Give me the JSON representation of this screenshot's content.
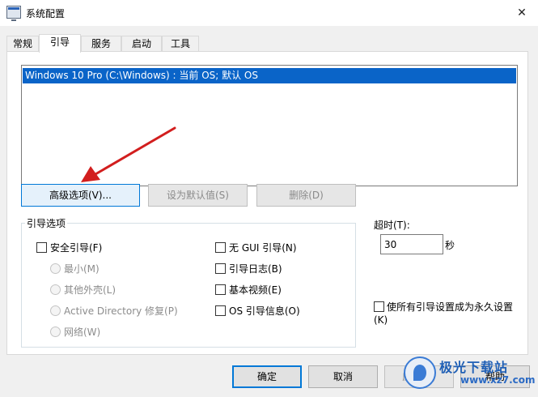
{
  "window": {
    "title": "系统配置",
    "close_glyph": "✕"
  },
  "tabs": [
    {
      "label": "常规"
    },
    {
      "label": "引导"
    },
    {
      "label": "服务"
    },
    {
      "label": "启动"
    },
    {
      "label": "工具"
    }
  ],
  "active_tab": "引导",
  "os_list": {
    "items": [
      "Windows 10 Pro (C:\\Windows) : 当前 OS; 默认 OS"
    ],
    "selected_index": 0
  },
  "buttons": {
    "advanced": "高级选项(V)...",
    "set_default": "设为默认值(S)",
    "delete": "删除(D)"
  },
  "boot_options": {
    "group_label": "引导选项",
    "safe_boot": {
      "label": "安全引导(F)",
      "checked": false
    },
    "radios": [
      {
        "label": "最小(M)"
      },
      {
        "label": "其他外壳(L)"
      },
      {
        "label": "Active Directory 修复(P)"
      },
      {
        "label": "网络(W)"
      }
    ],
    "right_checks": [
      {
        "label": "无 GUI 引导(N)",
        "checked": false
      },
      {
        "label": "引导日志(B)",
        "checked": false
      },
      {
        "label": "基本视频(E)",
        "checked": false
      },
      {
        "label": "OS 引导信息(O)",
        "checked": false
      }
    ]
  },
  "timeout": {
    "label": "超时(T):",
    "value": "30",
    "unit": "秒"
  },
  "permanent": {
    "label": "使所有引导设置成为永久设置(K)",
    "checked": false
  },
  "dialog_buttons": {
    "ok": "确定",
    "cancel": "取消",
    "apply": "应用(A)",
    "help": "帮助"
  },
  "watermark": {
    "brand": "极光下载站",
    "site": "www.xz7.com"
  },
  "colors": {
    "selection": "#0a64c8",
    "focus_border": "#0078d7",
    "arrow": "#d21e1e"
  },
  "icons": {
    "app": "system-config-icon",
    "close": "close-icon",
    "annotation": "red-arrow-icon"
  }
}
